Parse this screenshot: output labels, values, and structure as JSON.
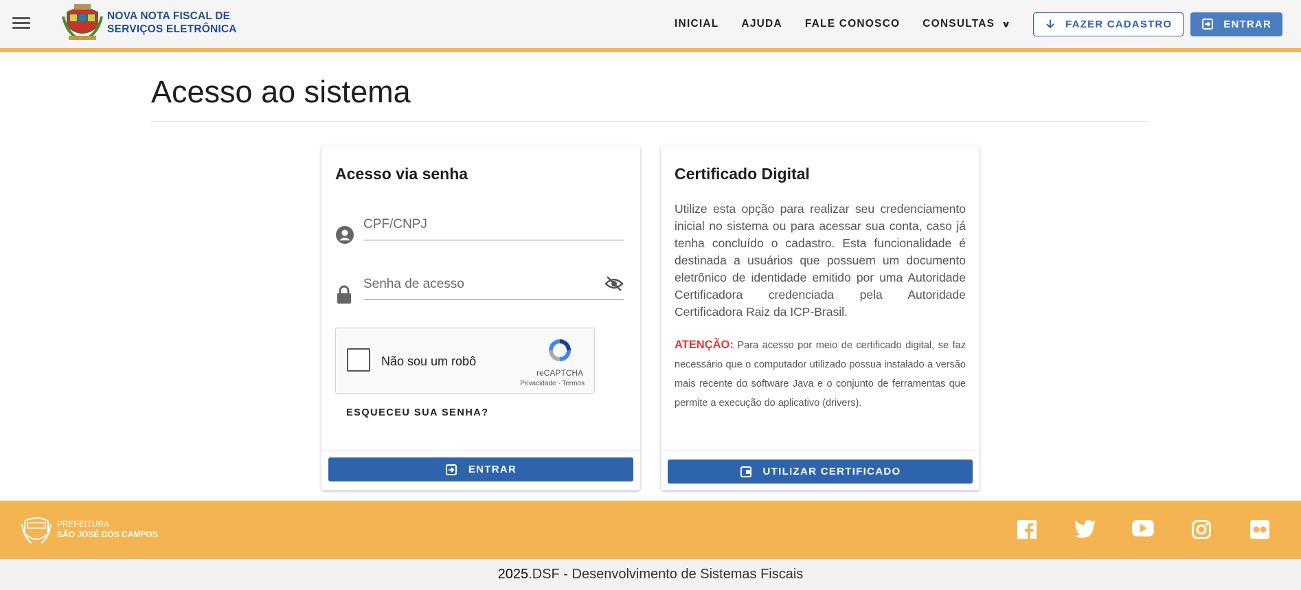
{
  "header": {
    "brand_line1": "NOVA NOTA FISCAL DE",
    "brand_line2": "SERVIÇOS ELETRÔNICA",
    "nav": [
      "INICIAL",
      "AJUDA",
      "FALE CONOSCO",
      "CONSULTAS"
    ],
    "register_label": "FAZER CADASTRO",
    "login_label": "ENTRAR"
  },
  "page": {
    "title": "Acesso ao sistema"
  },
  "password_card": {
    "title": "Acesso via senha",
    "cpf_placeholder": "CPF/CNPJ",
    "password_placeholder": "Senha de acesso",
    "captcha_label": "Não sou um robô",
    "captcha_brand": "reCAPTCHA",
    "captcha_links": "Privacidade - Termos",
    "forgot_label": "ESQUECEU SUA SENHA?",
    "submit_label": "ENTRAR"
  },
  "certificate_card": {
    "title": "Certificado Digital",
    "description": "Utilize esta opção para realizar seu credenciamento inicial no sistema ou para acessar sua conta, caso já tenha concluído o cadastro. Esta funcionalidade é destinada a usuários que possuem um documento eletrônico de identidade emitido por uma Autoridade Certificadora credenciada pela Autoridade Certificadora Raiz da ICP-Brasil.",
    "attention_label": "ATENÇÃO:",
    "attention_text": "Para acesso por meio de certificado digital, se faz necessário que o computador utilizado possua instalado a versão mais recente do software Java e o conjunto de ferramentas que permite a execução do aplicativo (drivers).",
    "submit_label": "UTILIZAR CERTIFICADO"
  },
  "footer": {
    "brand_line1": "PREFEITURA",
    "brand_line2": "SÃO JOSÉ DOS CAMPOS",
    "social": [
      "facebook-icon",
      "twitter-icon",
      "youtube-icon",
      "instagram-icon",
      "flickr-icon"
    ],
    "copyright_year": "2025.",
    "copyright_text": "DSF - Desenvolvimento de Sistemas Fiscais"
  },
  "colors": {
    "primary": "#2f64ad",
    "accent": "#f5b452",
    "attention": "#e53935",
    "brand_text": "#1f4d8f"
  }
}
